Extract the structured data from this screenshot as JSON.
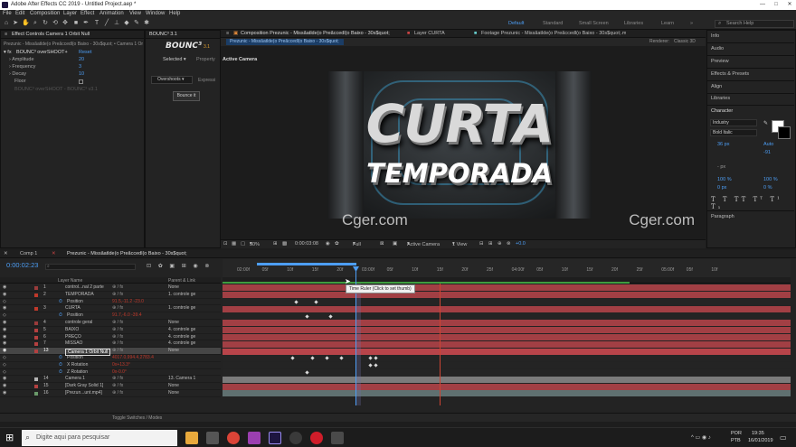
{
  "titlebar": {
    "title": "Adobe After Effects CC 2019 - Untitled Project.aep *",
    "min": "—",
    "max": "□",
    "close": "✕"
  },
  "menu": [
    "File",
    "Edit",
    "Composition",
    "Layer",
    "Effect",
    "Animation",
    "View",
    "Window",
    "Help"
  ],
  "workspaces": {
    "default": "Default",
    "standard": "Standard",
    "small_screen": "Small Screen",
    "libraries": "Libraries",
    "learn": "Learn",
    "more": "»",
    "search": "Search Help"
  },
  "effect_controls": {
    "tab": "Effect Controls Camera 1 Orbit Null",
    "path": "Prezunic - Missãatlde(o Preãccedl(o Baixo - 30s$quot; • Camera 1 Orbit Null",
    "fx_name": "BOUNC³ overSHOOT+",
    "reset": "Reset",
    "params": [
      {
        "name": "Amplitude",
        "value": "20"
      },
      {
        "name": "Frequency",
        "value": "3"
      },
      {
        "name": "Decay",
        "value": "10"
      },
      {
        "name": "Floor",
        "value": ""
      }
    ],
    "footer": "BOUNC³ overSHOOT - BOUNC³ v3.1"
  },
  "bounce_panel": {
    "tab": "BOUNC³ 3.1",
    "logo": "BOUNC³",
    "version": "3.1",
    "selected": "Selected",
    "property": "Property",
    "mode": "Overshoots",
    "expression": "Expressi",
    "button": "Bounce it"
  },
  "viewer": {
    "tabs": [
      "Composition Prezunic - Missãatlde(o Preãccedl(o Baixo - 30s$quot;",
      "Layer CURTA",
      "Footage Prezunic - Missãatlde(o Preãccedl(o Baixo - 30s$quot;.mp4"
    ],
    "subtab": "Prezunic - Missãatlde(o Preãccedl(o Baixo - 30s$quot;",
    "renderer_label": "Renderer:",
    "renderer": "Classic 3D",
    "active_camera": "Active Camera",
    "title_line1": "CURTA",
    "title_line2": "TEMPORADA",
    "watermark_left": "Cger.com",
    "watermark_right": "Cger.com",
    "zoom": "50%",
    "timecode": "0:00:03:08",
    "resolution": "Full",
    "camera": "Active Camera",
    "view": "1 View",
    "exposure": "+0.0"
  },
  "right_panel": {
    "items": [
      "Info",
      "Audio",
      "Preview",
      "Effects & Presets",
      "Align",
      "Libraries"
    ],
    "character": "Character",
    "font": "Industry",
    "style": "Bold Italic",
    "size": "36 px",
    "leading": "Auto",
    "tracking": "-91",
    "stroke_size": "- px",
    "vscale": "100 %",
    "hscale": "100 %",
    "baseline": "0 px",
    "tsume": "0 %",
    "paragraph": "Paragraph",
    "fill_color": "#ffffff",
    "stroke_color": "#000000"
  },
  "timeline": {
    "tabs": [
      "Comp 1",
      "Prezunic - Missãatlde(o Preãccedl(o Baixo - 30s$quot;"
    ],
    "timecode": "0:00:02:23",
    "col_layer": "Layer Name",
    "col_parent": "Parent & Link",
    "ruler": [
      "02:00f",
      "05f",
      "10f",
      "15f",
      "20f",
      "03:00f",
      "05f",
      "10f",
      "15f",
      "20f",
      "25f",
      "04:00f",
      "05f",
      "10f",
      "15f",
      "20f",
      "25f",
      "05:00f",
      "05f",
      "10f"
    ],
    "tooltip": "Time Ruler (Click to set thumb)",
    "footer": "Toggle Switches / Modes",
    "layers": [
      {
        "num": "1",
        "name": "control...nal 2 parte",
        "parent": "None",
        "kind": "layer"
      },
      {
        "num": "2",
        "name": "TEMPORADA",
        "parent": "1. controle ge",
        "kind": "layer"
      },
      {
        "num": "",
        "name": "Position",
        "value": "91.5,-11.2 -23.0",
        "kind": "prop"
      },
      {
        "num": "3",
        "name": "CURTA",
        "parent": "1. controle ge",
        "kind": "layer"
      },
      {
        "num": "",
        "name": "Position",
        "value": "91.7,-6.0 -39.4",
        "kind": "prop"
      },
      {
        "num": "4",
        "name": "controle geral",
        "parent": "None",
        "kind": "layer"
      },
      {
        "num": "5",
        "name": "BAIXO",
        "parent": "4. controle ge",
        "kind": "layer"
      },
      {
        "num": "6",
        "name": "PREÇO",
        "parent": "4. controle ge",
        "kind": "layer"
      },
      {
        "num": "7",
        "name": "MISSAO",
        "parent": "4. controle ge",
        "kind": "layer"
      },
      {
        "num": "13",
        "name": "Camera 1 Orbit Null",
        "parent": "None",
        "kind": "selected"
      },
      {
        "num": "",
        "name": "Position",
        "value": "4017.0,994.4,2783.4",
        "kind": "prop"
      },
      {
        "num": "",
        "name": "X Rotation",
        "value": "0x+13.3°",
        "kind": "prop"
      },
      {
        "num": "",
        "name": "Z Rotation",
        "value": "0x-0.0°",
        "kind": "prop"
      },
      {
        "num": "14",
        "name": "Camera 1",
        "parent": "13. Camera 1",
        "kind": "layer"
      },
      {
        "num": "15",
        "name": "[Dark Gray Solid 1]",
        "parent": "None",
        "kind": "layer"
      },
      {
        "num": "16",
        "name": "[Prezun...unt.mp4]",
        "parent": "None",
        "kind": "layer"
      }
    ]
  },
  "taskbar": {
    "search": "Digite aqui para pesquisar",
    "lang": "POR",
    "layout": "PTB",
    "time": "19:35",
    "date": "16/01/2019"
  },
  "colors": {
    "accent": "#4d9ef5",
    "bar_red": "#b8444a",
    "bar_gray": "#7b7b7b",
    "playhead": "#4d9ef5",
    "work_area": "#8a8a8a"
  }
}
